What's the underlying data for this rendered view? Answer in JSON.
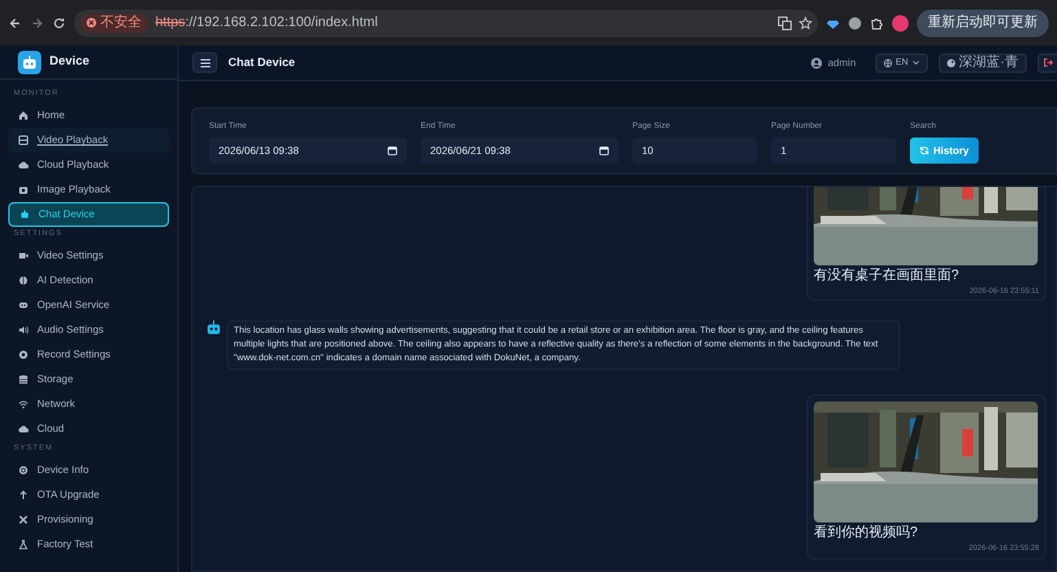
{
  "browser": {
    "security_label": "不安全",
    "url_scheme": "https",
    "url_rest": "://192.168.2.102:100/index.html",
    "update_button": "重新启动即可更新"
  },
  "sidebar": {
    "brand": "Device",
    "sections": [
      {
        "title": "MONITOR",
        "items": [
          {
            "label": "Home",
            "selected": false,
            "hovered": false
          },
          {
            "label": "Video Playback",
            "selected": false,
            "hovered": true
          },
          {
            "label": "Cloud Playback",
            "selected": false,
            "hovered": false
          },
          {
            "label": "Image Playback",
            "selected": false,
            "hovered": false
          },
          {
            "label": "Chat Device",
            "selected": true,
            "hovered": false
          }
        ]
      },
      {
        "title": "SETTINGS",
        "items": [
          {
            "label": "Video Settings",
            "selected": false,
            "hovered": false
          },
          {
            "label": "AI Detection",
            "selected": false,
            "hovered": false
          },
          {
            "label": "OpenAI Service",
            "selected": false,
            "hovered": false
          },
          {
            "label": "Audio Settings",
            "selected": false,
            "hovered": false
          },
          {
            "label": "Record Settings",
            "selected": false,
            "hovered": false
          },
          {
            "label": "Storage",
            "selected": false,
            "hovered": false
          },
          {
            "label": "Network",
            "selected": false,
            "hovered": false
          },
          {
            "label": "Cloud",
            "selected": false,
            "hovered": false
          }
        ]
      },
      {
        "title": "SYSTEM",
        "items": [
          {
            "label": "Device Info",
            "selected": false,
            "hovered": false
          },
          {
            "label": "OTA Upgrade",
            "selected": false,
            "hovered": false
          },
          {
            "label": "Provisioning",
            "selected": false,
            "hovered": false
          },
          {
            "label": "Factory Test",
            "selected": false,
            "hovered": false
          }
        ]
      }
    ]
  },
  "header": {
    "title": "Chat Device",
    "user": "admin",
    "language": "EN",
    "theme": "深湖蓝·青"
  },
  "filters": [
    {
      "label": "Start Time",
      "value": "2026/06/13 09:38",
      "kind": "datetime"
    },
    {
      "label": "End Time",
      "value": "2026/06/21 09:38",
      "kind": "datetime"
    },
    {
      "label": "Page Size",
      "value": "10",
      "kind": "number"
    },
    {
      "label": "Page Number",
      "value": "1",
      "kind": "number"
    }
  ],
  "search": {
    "label": "Search",
    "button": "History"
  },
  "messages": [
    {
      "kind": "user",
      "text": "有没有桌子在画面里面?",
      "time": "2026-06-16 23:55:11",
      "cut_top": true
    },
    {
      "kind": "bot",
      "text": "This location has glass walls showing advertisements, suggesting that it could be a retail store or an exhibition area. The floor is gray, and the ceiling features multiple lights that are positioned above. The ceiling also appears to have a reflective quality as there's a reflection of some elements in the background. The text \"www.dok-net.com.cn\" indicates a domain name associated with DokuNet, a company."
    },
    {
      "kind": "user",
      "text": "看到你的视频吗?",
      "time": "2026-06-16 23:55:28",
      "cut_top": false
    }
  ]
}
